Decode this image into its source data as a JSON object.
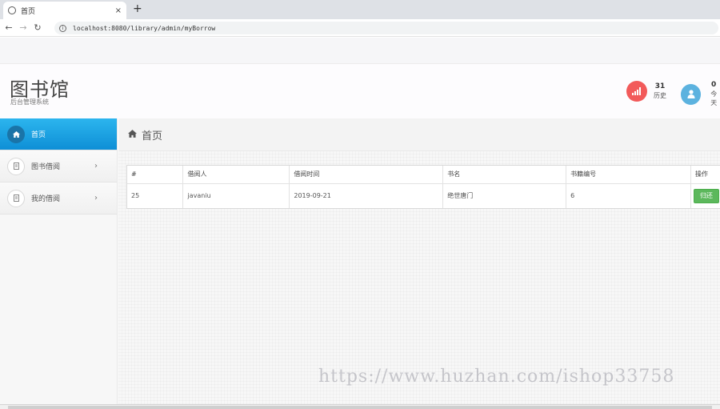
{
  "browser": {
    "tab_title": "首页",
    "tab_close": "×",
    "new_tab": "+",
    "url": "localhost:8080/library/admin/myBorrow"
  },
  "header": {
    "brand_title": "图书馆",
    "brand_subtitle": "后台管理系统",
    "stats": [
      {
        "value": "31",
        "label": "历史",
        "color": "#f25a5a",
        "icon": "signal-icon"
      },
      {
        "value": "0",
        "label": "今天",
        "color": "#5cb2df",
        "icon": "user-icon"
      }
    ]
  },
  "sidebar": {
    "items": [
      {
        "label": "首页",
        "icon": "home-icon",
        "active": true
      },
      {
        "label": "图书借阅",
        "icon": "book-icon",
        "active": false
      },
      {
        "label": "我的借阅",
        "icon": "book-icon",
        "active": false
      }
    ]
  },
  "breadcrumb": {
    "title": "首页"
  },
  "table": {
    "headers": [
      "#",
      "借阅人",
      "借阅时间",
      "书名",
      "书籍编号",
      "操作"
    ],
    "rows": [
      {
        "id": "25",
        "borrower": "javaniu",
        "time": "2019-09-21",
        "book": "绝世唐门",
        "book_no": "6",
        "action": "归还"
      }
    ]
  },
  "watermark": "https://www.huzhan.com/ishop33758",
  "colors": {
    "accent": "#1496dc",
    "danger": "#f25a5a",
    "info": "#5cb2df",
    "success": "#5cb85c"
  }
}
